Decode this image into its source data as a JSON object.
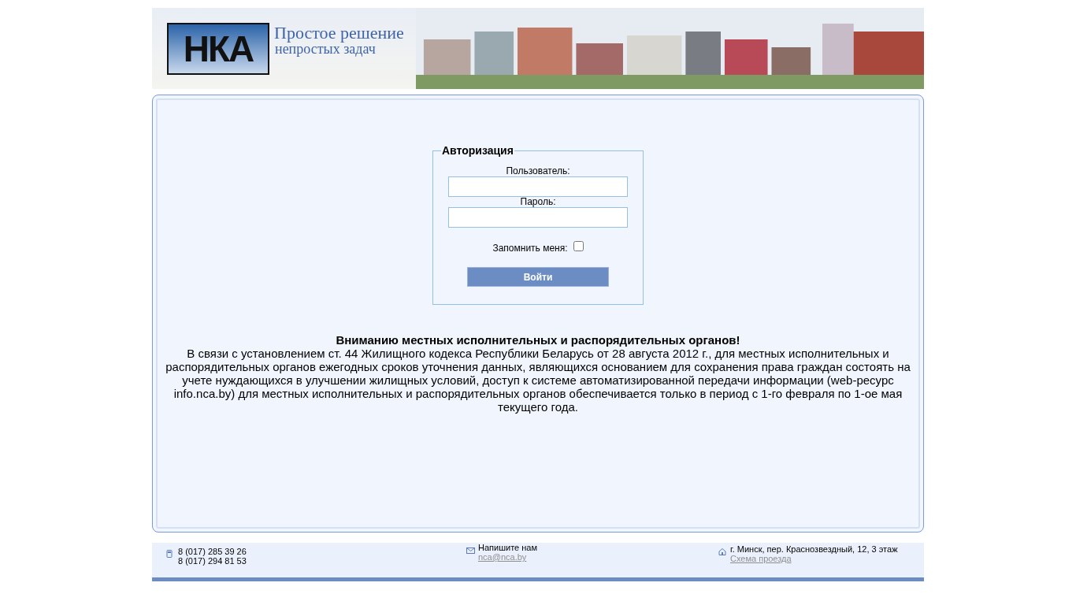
{
  "header": {
    "logo": "НКА",
    "tagline_line_1": "Простое решение",
    "tagline_line_2": "непростых задач"
  },
  "login": {
    "title": "Авторизация",
    "username_label": "Пользователь:",
    "password_label": "Пароль:",
    "remember_label": "Запомнить меня:",
    "remember_checked": false,
    "submit": "Войти"
  },
  "notice": {
    "heading": "Вниманию местных исполнительных и распорядительных органов!",
    "text": "В связи с установлением ст. 44 Жилищного кодекса Республики Беларусь от 28 августа 2012 г., для местных исполнительных и распорядительных органов ежегодных сроков уточнения данных, являющихся основанием для сохранения права граждан состоять на учете нуждающихся в улучшении жилищных условий, доступ к системе автоматизированной передачи информации (web-ресурс info.nca.by) для местных исполнительных и распорядительных органов обеспечивается только в период с 1-го февраля по 1-ое мая текущего года."
  },
  "footer": {
    "phones": [
      "8 (017) 285 39 26",
      "8 (017) 294 81 53"
    ],
    "write_label": "Напишите нам",
    "email": "nca@nca.by",
    "address": "г. Минск, пер. Краснозвездный, 12, 3 этаж",
    "map_link": "Схема проезда"
  }
}
